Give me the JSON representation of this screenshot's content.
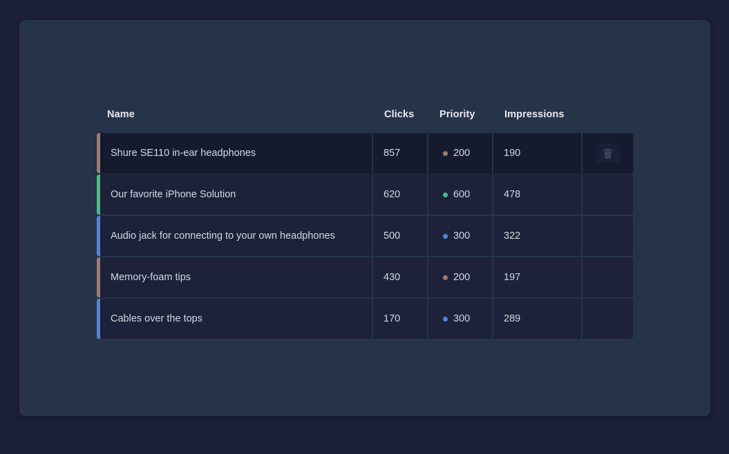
{
  "table": {
    "headers": {
      "name": "Name",
      "clicks": "Clicks",
      "priority": "Priority",
      "impressions": "Impressions"
    },
    "rows": [
      {
        "name": "Shure SE110 in-ear headphones",
        "clicks": "857",
        "priority": "200",
        "impressions": "190",
        "accent_color": "#a07c68",
        "priority_color": "#a07c68",
        "selected": true
      },
      {
        "name": "Our favorite iPhone Solution",
        "clicks": "620",
        "priority": "600",
        "impressions": "478",
        "accent_color": "#3bc47f",
        "priority_color": "#3bc47f",
        "selected": false
      },
      {
        "name": "Audio jack for connecting to your own headphones",
        "clicks": "500",
        "priority": "300",
        "impressions": "322",
        "accent_color": "#5186e0",
        "priority_color": "#5186e0",
        "selected": false
      },
      {
        "name": "Memory-foam tips",
        "clicks": "430",
        "priority": "200",
        "impressions": "197",
        "accent_color": "#a07c68",
        "priority_color": "#a07c68",
        "selected": false
      },
      {
        "name": "Cables over the tops",
        "clicks": "170",
        "priority": "300",
        "impressions": "289",
        "accent_color": "#5186e0",
        "priority_color": "#5186e0",
        "selected": false
      }
    ],
    "delete_icon": "trash-icon"
  },
  "colors": {
    "background": "#1c2038",
    "panel": "#273349",
    "row": "#1d213a",
    "row_selected": "#151b2f"
  }
}
